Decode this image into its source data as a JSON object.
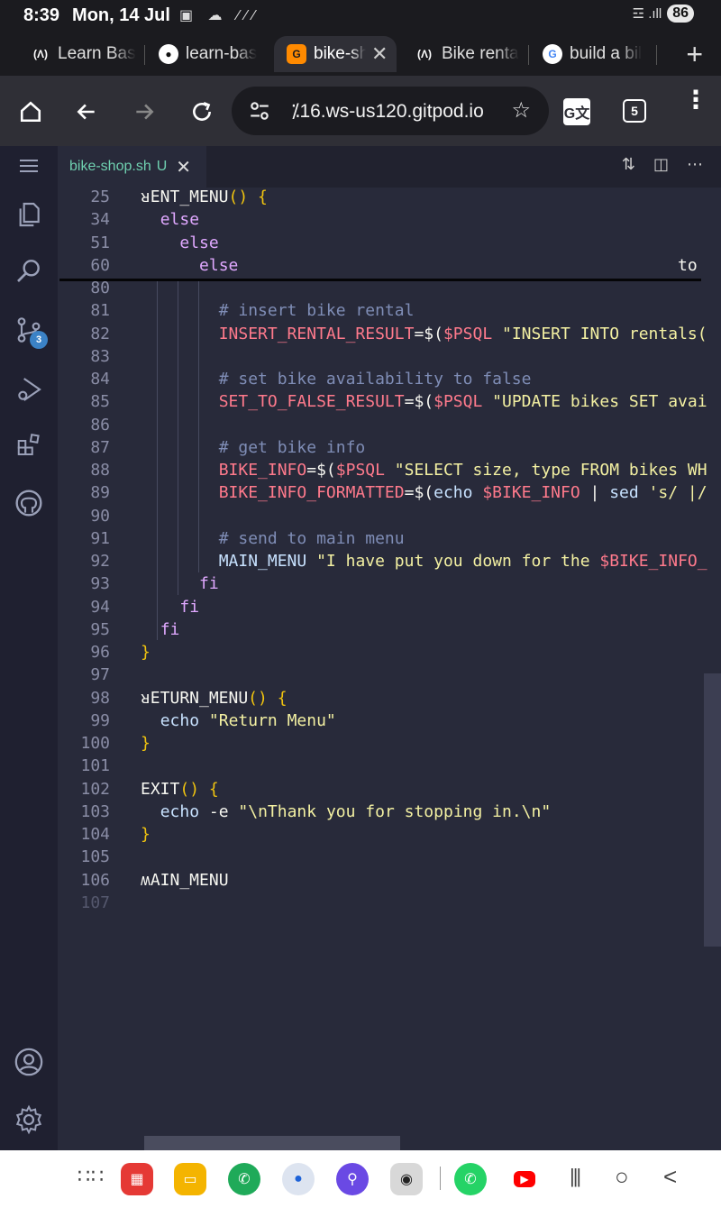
{
  "status": {
    "time": "8:39",
    "date": "Mon, 14 Jul",
    "status_icons": "▣ ☁ ∕∕∕",
    "signal": "☲ .ıll",
    "battery": "86"
  },
  "tabs": [
    {
      "label": "Learn Bas",
      "icon": "freecodecamp-icon"
    },
    {
      "label": "learn-bas",
      "icon": "github-icon"
    },
    {
      "label": "bike-sh",
      "icon": "gitpod-icon",
      "close": "✕"
    },
    {
      "label": "Bike renta",
      "icon": "freecodecamp-icon"
    },
    {
      "label": "build a bil",
      "icon": "google-icon"
    }
  ],
  "new_tab_label": "+",
  "omnibox": {
    "url": "⁒16.ws-us120.gitpod.io"
  },
  "tab_count": "5",
  "editor": {
    "tab": {
      "filename": "bike-shop.sh",
      "status": "U",
      "close": "✕"
    },
    "activity_badge": "3"
  },
  "sticky_lines": [
    {
      "n": "25",
      "tokens": [
        [
          "fn",
          "ᴚENT_MENU"
        ],
        [
          "paren",
          "()"
        ],
        [
          "op",
          " "
        ],
        [
          "paren",
          "{"
        ]
      ]
    },
    {
      "n": "34",
      "tokens": [
        [
          "op",
          "  "
        ],
        [
          "kw",
          "else"
        ]
      ]
    },
    {
      "n": "51",
      "tokens": [
        [
          "op",
          "    "
        ],
        [
          "kw",
          "else"
        ]
      ]
    },
    {
      "n": "60",
      "tokens": [
        [
          "op",
          "      "
        ],
        [
          "kw",
          "else"
        ],
        [
          "op",
          "                                             to"
        ]
      ]
    }
  ],
  "lines": [
    {
      "n": "80",
      "tokens": []
    },
    {
      "n": "81",
      "tokens": [
        [
          "op",
          "        "
        ],
        [
          "cm",
          "# insert bike rental"
        ]
      ]
    },
    {
      "n": "82",
      "tokens": [
        [
          "op",
          "        "
        ],
        [
          "var",
          "INSERT_RENTAL_RESULT"
        ],
        [
          "op",
          "=$("
        ],
        [
          "var",
          "$PSQL"
        ],
        [
          "op",
          " "
        ],
        [
          "str",
          "\"INSERT INTO rentals("
        ]
      ]
    },
    {
      "n": "83",
      "tokens": []
    },
    {
      "n": "84",
      "tokens": [
        [
          "op",
          "        "
        ],
        [
          "cm",
          "# set bike availability to false"
        ]
      ]
    },
    {
      "n": "85",
      "tokens": [
        [
          "op",
          "        "
        ],
        [
          "var",
          "SET_TO_FALSE_RESULT"
        ],
        [
          "op",
          "=$("
        ],
        [
          "var",
          "$PSQL"
        ],
        [
          "op",
          " "
        ],
        [
          "str",
          "\"UPDATE bikes SET avai"
        ]
      ]
    },
    {
      "n": "86",
      "tokens": []
    },
    {
      "n": "87",
      "tokens": [
        [
          "op",
          "        "
        ],
        [
          "cm",
          "# get bike info"
        ]
      ]
    },
    {
      "n": "88",
      "tokens": [
        [
          "op",
          "        "
        ],
        [
          "var",
          "BIKE_INFO"
        ],
        [
          "op",
          "=$("
        ],
        [
          "var",
          "$PSQL"
        ],
        [
          "op",
          " "
        ],
        [
          "str",
          "\"SELECT size, type FROM bikes WH"
        ]
      ]
    },
    {
      "n": "89",
      "tokens": [
        [
          "op",
          "        "
        ],
        [
          "var",
          "BIKE_INFO_FORMATTED"
        ],
        [
          "op",
          "=$("
        ],
        [
          "cmd",
          "echo"
        ],
        [
          "op",
          " "
        ],
        [
          "var",
          "$BIKE_INFO"
        ],
        [
          "op",
          " | "
        ],
        [
          "cmd",
          "sed"
        ],
        [
          "op",
          " "
        ],
        [
          "str",
          "'s/ |/"
        ]
      ]
    },
    {
      "n": "90",
      "tokens": []
    },
    {
      "n": "91",
      "tokens": [
        [
          "op",
          "        "
        ],
        [
          "cm",
          "# send to main menu"
        ]
      ]
    },
    {
      "n": "92",
      "tokens": [
        [
          "op",
          "        "
        ],
        [
          "cmd",
          "MAIN_MENU"
        ],
        [
          "op",
          " "
        ],
        [
          "str",
          "\"I have put you down for the "
        ],
        [
          "var",
          "$BIKE_INFO_"
        ]
      ]
    },
    {
      "n": "93",
      "tokens": [
        [
          "op",
          "      "
        ],
        [
          "kw",
          "fi"
        ]
      ]
    },
    {
      "n": "94",
      "tokens": [
        [
          "op",
          "    "
        ],
        [
          "kw",
          "fi"
        ]
      ]
    },
    {
      "n": "95",
      "tokens": [
        [
          "op",
          "  "
        ],
        [
          "kw",
          "fi"
        ]
      ]
    },
    {
      "n": "96",
      "tokens": [
        [
          "paren",
          "}"
        ]
      ]
    },
    {
      "n": "97",
      "tokens": []
    },
    {
      "n": "98",
      "tokens": [
        [
          "fn",
          "ᴚETURN_MENU"
        ],
        [
          "paren",
          "()"
        ],
        [
          "op",
          " "
        ],
        [
          "paren",
          "{"
        ]
      ]
    },
    {
      "n": "99",
      "tokens": [
        [
          "op",
          "  "
        ],
        [
          "cmd",
          "echo"
        ],
        [
          "op",
          " "
        ],
        [
          "str",
          "\"Return Menu\""
        ]
      ]
    },
    {
      "n": "100",
      "tokens": [
        [
          "paren",
          "}"
        ]
      ]
    },
    {
      "n": "101",
      "tokens": []
    },
    {
      "n": "102",
      "tokens": [
        [
          "fn",
          "ΕXIT"
        ],
        [
          "paren",
          "()"
        ],
        [
          "op",
          " "
        ],
        [
          "paren",
          "{"
        ]
      ]
    },
    {
      "n": "103",
      "tokens": [
        [
          "op",
          "  "
        ],
        [
          "cmd",
          "echo"
        ],
        [
          "op",
          " -e "
        ],
        [
          "str",
          "\"\\nThank you for stopping in.\\n\""
        ]
      ]
    },
    {
      "n": "104",
      "tokens": [
        [
          "paren",
          "}"
        ]
      ]
    },
    {
      "n": "105",
      "tokens": []
    },
    {
      "n": "106",
      "tokens": [
        [
          "fn",
          "ʍAIN_MENU"
        ]
      ]
    },
    {
      "n": "107",
      "tokens": [],
      "dim": true
    }
  ],
  "colors": {
    "accent_badge": "#3b82c6",
    "editor_bg": "#282a3a",
    "sidebar_bg": "#1f2030"
  },
  "dock_apps": [
    "apps-grid-icon",
    "notes-icon",
    "files-icon",
    "phone-icon",
    "messages-icon",
    "internet-icon",
    "camera-icon",
    "whatsapp-icon",
    "youtube-icon"
  ],
  "nav_buttons": {
    "recents": "|||",
    "home": "○",
    "back": "<"
  }
}
